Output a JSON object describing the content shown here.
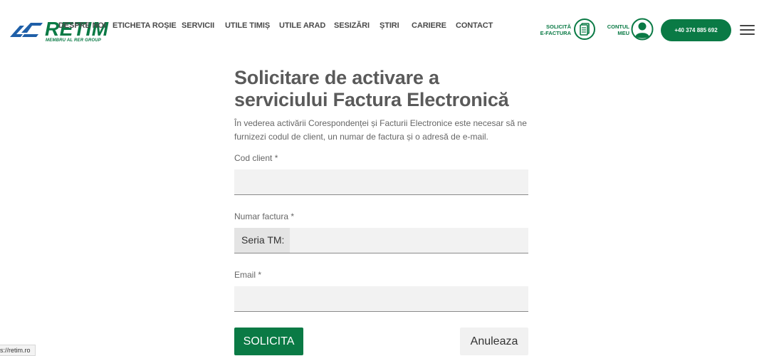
{
  "header": {
    "logo_text": "RETIM",
    "logo_sub": "MEMBRU AL RER GROUP",
    "nav": [
      "DESPRE NOI",
      "ETICHETA ROȘIE",
      "SERVICII",
      "UTILE TIMIȘ",
      "UTILE ARAD",
      "SESIZĂRI",
      "ȘTIRI",
      "CARIERE",
      "CONTACT"
    ],
    "efactura_line1": "SOLICITĂ",
    "efactura_line2": "E-FACTURA",
    "contul_line1": "CONTUL",
    "contul_line2": "MEU",
    "phone": "+40 374 885 692"
  },
  "form": {
    "title": "Solicitare de activare a serviciului Factura Electronică",
    "intro": "În vederea activării Corespondenței și Facturii Electronice este necesar să ne furnizezi codul de client, un numar de factura și o adresă de e-mail.",
    "cod_client_label": "Cod client *",
    "cod_client_value": "",
    "numar_factura_label": "Numar factura *",
    "numar_factura_prefix": "Seria TM:",
    "numar_factura_value": "",
    "email_label": "Email *",
    "email_value": "",
    "submit_label": "SOLICITA",
    "cancel_label": "Anuleaza"
  },
  "status_bar": {
    "url": "s://retim.ro"
  },
  "colors": {
    "brand_green": "#0a7a45",
    "text_gray": "#5a5a5a",
    "field_bg": "#f2f2f2"
  },
  "icons": [
    "retim-logo-icon",
    "document-icon",
    "user-icon",
    "hamburger-icon"
  ]
}
